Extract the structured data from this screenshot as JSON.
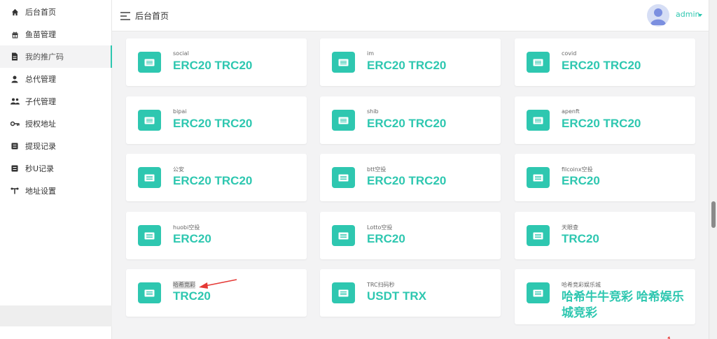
{
  "sidebar": {
    "items": [
      {
        "label": "后台首页",
        "icon": "home-icon"
      },
      {
        "label": "鱼苗管理",
        "icon": "gift-icon"
      },
      {
        "label": "我的推广码",
        "icon": "document-icon"
      },
      {
        "label": "总代管理",
        "icon": "user-icon"
      },
      {
        "label": "子代管理",
        "icon": "users-icon"
      },
      {
        "label": "授权地址",
        "icon": "key-icon"
      },
      {
        "label": "提现记录",
        "icon": "list-icon"
      },
      {
        "label": "秒U记录",
        "icon": "list-icon"
      },
      {
        "label": "地址设置",
        "icon": "wrench-icon"
      }
    ],
    "active_index": 2
  },
  "header": {
    "title": "后台首页",
    "username": "admin"
  },
  "cards": [
    {
      "label": "social",
      "value": "ERC20 TRC20"
    },
    {
      "label": "im",
      "value": "ERC20 TRC20"
    },
    {
      "label": "covid",
      "value": "ERC20 TRC20"
    },
    {
      "label": "bipai",
      "value": "ERC20 TRC20"
    },
    {
      "label": "shib",
      "value": "ERC20 TRC20"
    },
    {
      "label": "apenft",
      "value": "ERC20 TRC20"
    },
    {
      "label": "公安",
      "value": "ERC20 TRC20"
    },
    {
      "label": "btt空投",
      "value": "ERC20 TRC20"
    },
    {
      "label": "filcoinx空投",
      "value": "ERC20"
    },
    {
      "label": "huobi空投",
      "value": "ERC20"
    },
    {
      "label": "Lotto空投",
      "value": "ERC20"
    },
    {
      "label": "天眼查",
      "value": "TRC20"
    },
    {
      "label": "哈希竞彩",
      "value": "TRC20"
    },
    {
      "label": "TRC扫码秒",
      "value": "USDT TRX"
    },
    {
      "label": "哈希竞彩娱乐城",
      "value": "哈希牛牛竞彩 哈希娱乐城竞彩"
    }
  ],
  "colors": {
    "accent": "#2ec7b0",
    "annotation": "#e53935"
  }
}
